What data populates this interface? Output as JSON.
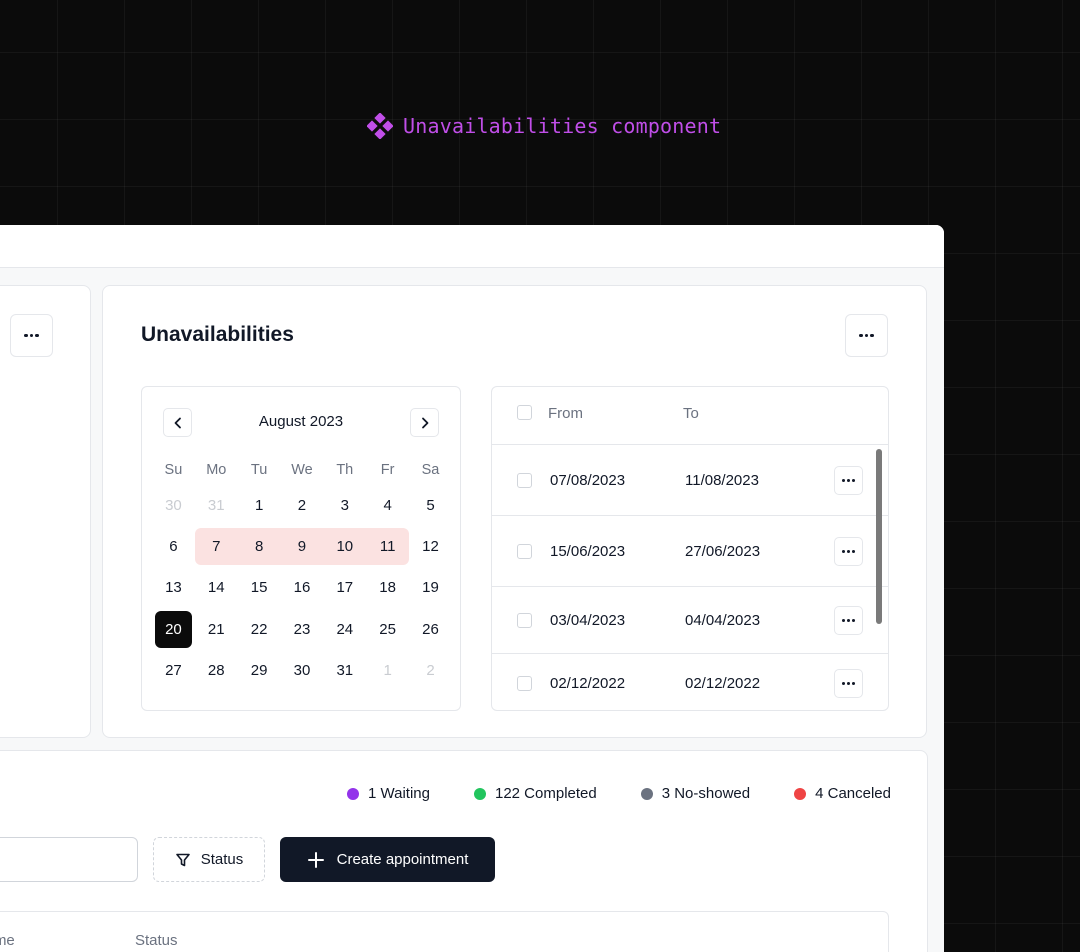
{
  "header": {
    "component_label": "Unavailabilities component"
  },
  "unavailabilities": {
    "title": "Unavailabilities",
    "calendar": {
      "month_label": "August 2023",
      "weekdays": [
        "Su",
        "Mo",
        "Tu",
        "We",
        "Th",
        "Fr",
        "Sa"
      ],
      "weeks": [
        [
          "30",
          "31",
          "1",
          "2",
          "3",
          "4",
          "5"
        ],
        [
          "6",
          "7",
          "8",
          "9",
          "10",
          "11",
          "12"
        ],
        [
          "13",
          "14",
          "15",
          "16",
          "17",
          "18",
          "19"
        ],
        [
          "20",
          "21",
          "22",
          "23",
          "24",
          "25",
          "26"
        ],
        [
          "27",
          "28",
          "29",
          "30",
          "31",
          "1",
          "2"
        ]
      ],
      "selected_range": [
        "7",
        "11"
      ],
      "today": "20"
    },
    "table": {
      "columns": {
        "from": "From",
        "to": "To"
      },
      "rows": [
        {
          "from": "07/08/2023",
          "to": "11/08/2023"
        },
        {
          "from": "15/06/2023",
          "to": "27/06/2023"
        },
        {
          "from": "03/04/2023",
          "to": "04/04/2023"
        },
        {
          "from": "02/12/2022",
          "to": "02/12/2022"
        }
      ]
    }
  },
  "appointments": {
    "stats": [
      {
        "label": "1 Waiting",
        "color": "#9333ea"
      },
      {
        "label": "122 Completed",
        "color": "#22c55e"
      },
      {
        "label": "3 No-showed",
        "color": "#6b7280"
      },
      {
        "label": "4 Canceled",
        "color": "#ef4444"
      }
    ],
    "status_filter_label": "Status",
    "create_button_label": "Create appointment",
    "columns": {
      "time": "Time",
      "status": "Status"
    }
  },
  "icons": {
    "component": "diamond-cluster-icon",
    "more": "more-horizontal-icon",
    "prev": "chevron-left-icon",
    "next": "chevron-right-icon",
    "filter": "filter-icon",
    "plus": "plus-icon"
  },
  "colors": {
    "accent": "#c04ee8",
    "range_highlight": "#fbe2e1",
    "primary_button": "#111827"
  }
}
